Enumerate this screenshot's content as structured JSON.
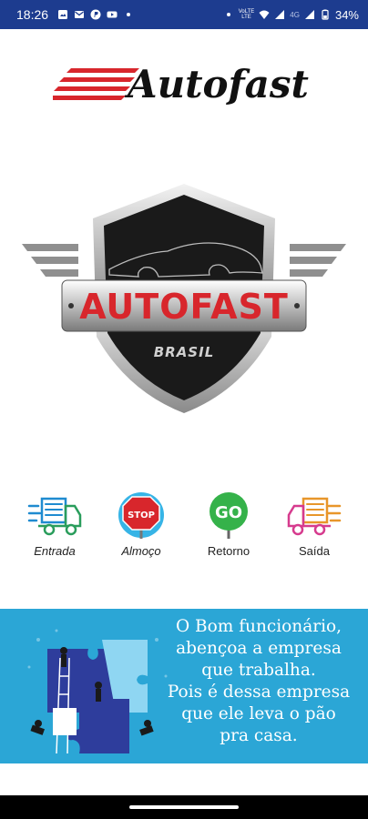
{
  "status_bar": {
    "time": "18:26",
    "network_label_top": "VoLTE",
    "network_label_lte": "LTE",
    "network_type": "4G",
    "battery": "34%",
    "notification_icons": [
      "photo-icon",
      "gmail-icon",
      "paypal-icon",
      "youtube-icon",
      "dot-icon"
    ]
  },
  "brand": {
    "name": "Autofast"
  },
  "emblem": {
    "title": "AUTOFAST",
    "subtitle": "BRASIL"
  },
  "actions": [
    {
      "id": "entrada",
      "label": "Entrada",
      "icon": "truck-icon",
      "color": "#2a9d5c"
    },
    {
      "id": "almoco",
      "label": "Almoço",
      "icon": "stop-sign-icon",
      "sign_text": "STOP",
      "color": "#d8262c"
    },
    {
      "id": "retorno",
      "label": "Retorno",
      "icon": "go-sign-icon",
      "sign_text": "GO",
      "color": "#35b24a"
    },
    {
      "id": "saida",
      "label": "Saída",
      "icon": "truck-icon",
      "color": "#d63b8e"
    }
  ],
  "banner": {
    "lines": [
      "O Bom funcionário,",
      "abençoa a empresa",
      "que trabalha.",
      "Pois é dessa empresa",
      "que ele leva o pão",
      "pra casa."
    ],
    "background": "#2ba6d6"
  },
  "colors": {
    "status_bar": "#1d3c8f",
    "brand_red": "#d8262c"
  }
}
